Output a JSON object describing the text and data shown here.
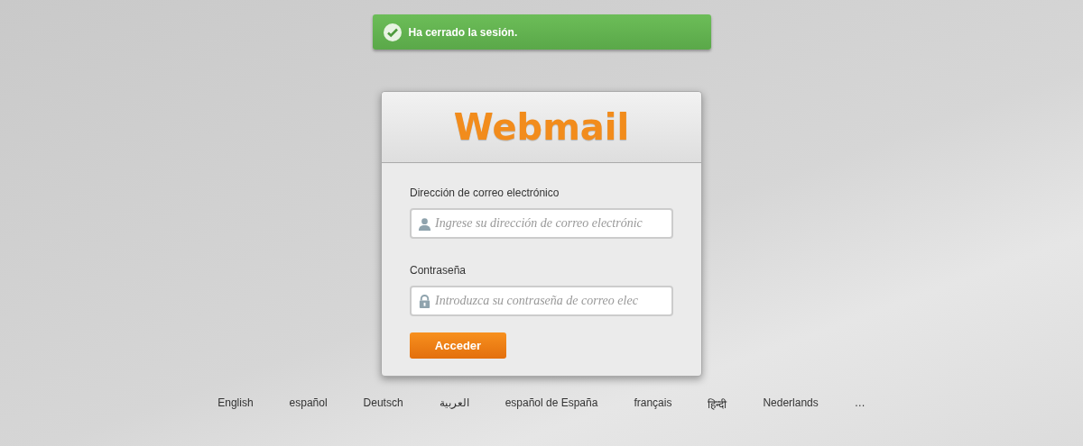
{
  "notice": {
    "kind": "success",
    "message": "Ha cerrado la sesión."
  },
  "login": {
    "logo": "Webmail",
    "fields": [
      {
        "kind": "email",
        "label": "Dirección de correo electrónico",
        "placeholder": "Ingrese su dirección de correo electrónic"
      },
      {
        "kind": "password",
        "label": "Contraseña",
        "placeholder": "Introduzca su contraseña de correo elec"
      }
    ],
    "submit": "Acceder"
  },
  "languages": [
    "English",
    "español",
    "Deutsch",
    "العربية",
    "español de España",
    "français",
    "हिन्दी",
    "Nederlands",
    "…"
  ]
}
